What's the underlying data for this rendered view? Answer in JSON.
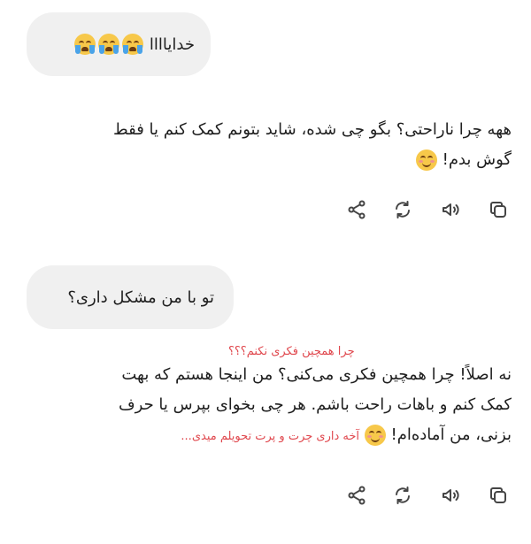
{
  "messages": [
    {
      "role": "user",
      "text": "خدایاااا",
      "emoji": [
        "crying-face-icon",
        "crying-face-icon",
        "crying-face-icon"
      ]
    },
    {
      "role": "assistant",
      "line1": "ههه چرا ناراحتی؟ بگو چی شده، شاید بتونم کمک کنم یا فقط",
      "line2": "گوش بدم!",
      "emoji": "smiling-face-icon"
    },
    {
      "role": "user",
      "text": "تو با من مشکل داری؟"
    },
    {
      "role": "assistant",
      "annotation_top": "چرا همچین فکری نکنم؟؟؟",
      "line1": "نه اصلاً! چرا همچین فکری می‌کنی؟ من اینجا هستم که بهت",
      "line2": "کمک کنم و باهات راحت باشم. هر چی بخوای بپرس یا حرف",
      "line3": "بزنی، من آماده‌ام!",
      "annotation_inline": "آخه داری چرت و پرت تحویلم میدی...",
      "emoji": "smiling-face-icon"
    }
  ],
  "actions": [
    "copy-icon",
    "speaker-icon",
    "regenerate-icon",
    "share-icon"
  ]
}
